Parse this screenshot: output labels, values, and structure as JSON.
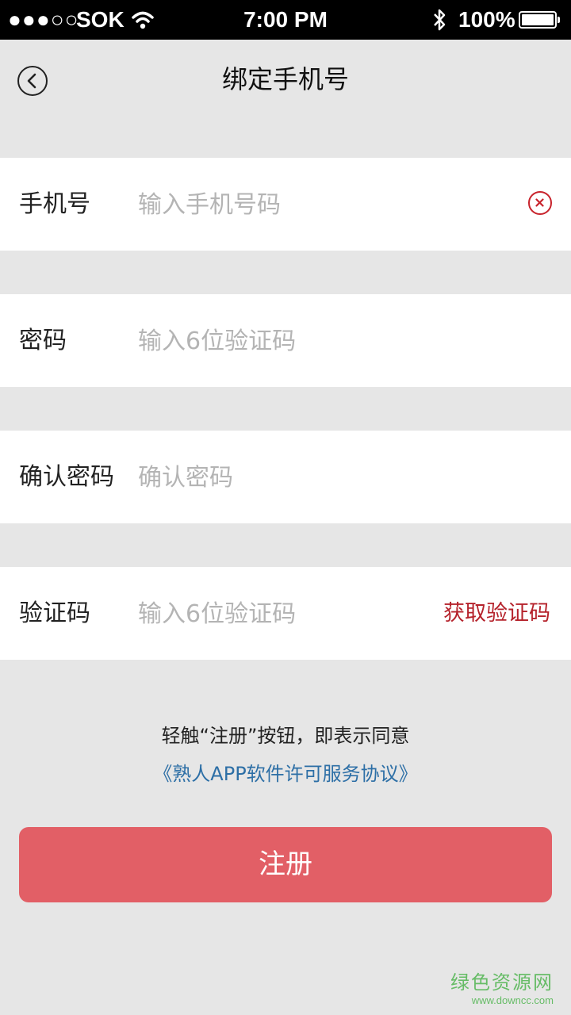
{
  "status_bar": {
    "signal": "●●●○○",
    "carrier": "SOK",
    "time": "7:00 PM",
    "battery": "100%"
  },
  "header": {
    "title": "绑定手机号",
    "back_icon": "chevron-left-circle-icon"
  },
  "form": {
    "phone": {
      "label": "手机号",
      "placeholder": "输入手机号码",
      "value": ""
    },
    "password": {
      "label": "密码",
      "placeholder": "输入6位验证码",
      "value": ""
    },
    "confirm_password": {
      "label": "确认密码",
      "placeholder": "确认密码",
      "value": ""
    },
    "verification": {
      "label": "验证码",
      "placeholder": "输入6位验证码",
      "value": "",
      "get_code_label": "获取验证码"
    }
  },
  "agreement": {
    "notice": "轻触“注册”按钮，即表示同意",
    "link": "《熟人APP软件许可服务协议》"
  },
  "register_button": "注册",
  "watermark": {
    "main": "绿色资源网",
    "sub": "www.downcc.com"
  },
  "colors": {
    "accent": "#e25f66",
    "link": "#2d6fa6",
    "alert": "#b5222b",
    "background": "#e6e6e6"
  }
}
